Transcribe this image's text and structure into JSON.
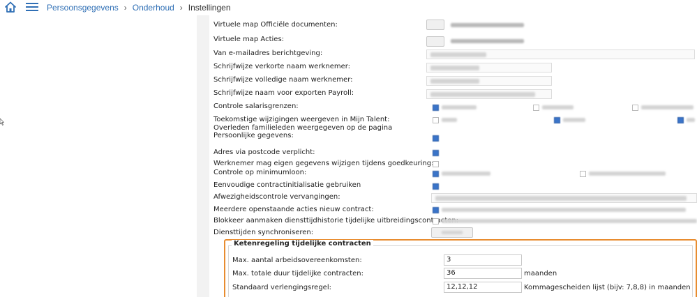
{
  "breadcrumb": {
    "item1": "Persoonsgegevens",
    "item2": "Onderhoud",
    "current": "Instellingen",
    "separator": "›"
  },
  "settings": {
    "rows": [
      "Virtuele map Officiële documenten:",
      "Virtuele map Acties:",
      "Van e-mailadres berichtgeving:",
      "Schrijfwijze verkorte naam werknemer:",
      "Schrijfwijze volledige naam werknemer:",
      "Schrijfwijze naam voor exporten Payroll:",
      "Controle salarisgrenzen:",
      "Toekomstige wijzigingen weergeven in Mijn Talent:",
      "Overleden familieleden weergegeven op de pagina Persoonlijke gegevens:",
      "Adres via postcode verplicht:",
      "Werknemer mag eigen gegevens wijzigen tijdens goedkeuring:",
      "Controle op minimumloon:",
      "Eenvoudige contractinitialisatie gebruiken",
      "Afwezigheidscontrole vervangingen:",
      "Meerdere openstaande acties nieuw contract:",
      "Blokkeer aanmaken diensttijdhistorie tijdelijke uitbreidingscontracten:",
      "Diensttijden synchroniseren:"
    ]
  },
  "ketenregeling": {
    "legend": "Ketenregeling tijdelijke contracten",
    "max_contracts_label": "Max. aantal arbeidsovereenkomsten:",
    "max_contracts_value": "3",
    "max_duration_label": "Max. totale duur tijdelijke contracten:",
    "max_duration_value": "36",
    "max_duration_unit": "maanden",
    "extension_rule_label": "Standaard verlengingsregel:",
    "extension_rule_value": "12,12,12",
    "extension_rule_hint": "Kommagescheiden lijst (bijv: 7,8,8) in maanden"
  },
  "colors": {
    "accent_blue": "#2f6fb5",
    "highlight_orange": "#e88c2f"
  },
  "icons": [
    "home-icon",
    "menu-icon",
    "chevron-right-icon"
  ]
}
